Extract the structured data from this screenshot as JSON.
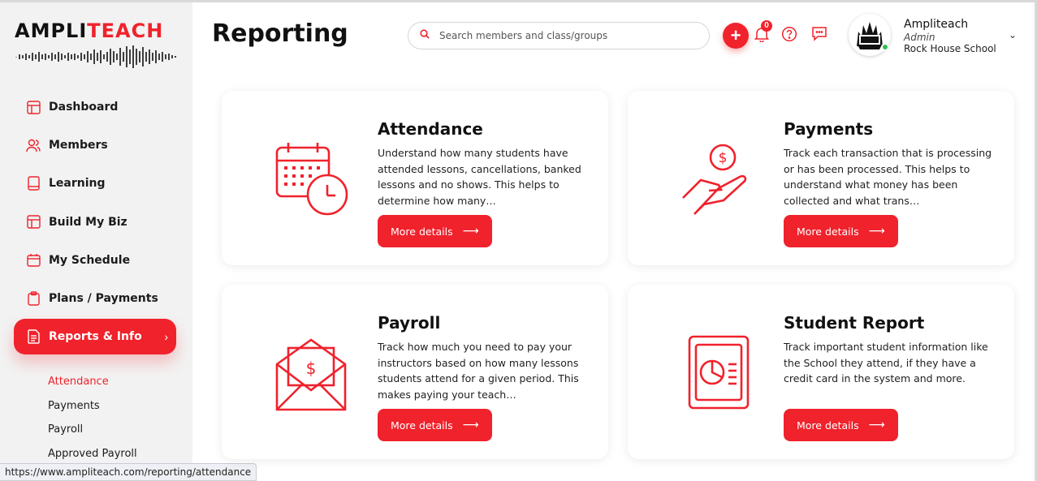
{
  "brand": {
    "logo_word_1": "AMPLI",
    "logo_word_2": "TEACH",
    "accent": "#f0222c"
  },
  "sidebar": {
    "items": [
      {
        "label": "Dashboard",
        "icon": "dashboard-icon"
      },
      {
        "label": "Members",
        "icon": "members-icon"
      },
      {
        "label": "Learning",
        "icon": "book-icon"
      },
      {
        "label": "Build My Biz",
        "icon": "layout-icon"
      },
      {
        "label": "My Schedule",
        "icon": "calendar-icon"
      },
      {
        "label": "Plans / Payments",
        "icon": "clipboard-icon"
      },
      {
        "label": "Reports & Info",
        "icon": "report-icon",
        "active": true
      }
    ],
    "sub_items": [
      {
        "label": "Attendance",
        "active": true
      },
      {
        "label": "Payments"
      },
      {
        "label": "Payroll"
      },
      {
        "label": "Approved Payroll"
      }
    ]
  },
  "header": {
    "title": "Reporting",
    "search_placeholder": "Search members and class/groups",
    "notification_count": "0",
    "user": {
      "name": "Ampliteach",
      "role": "Admin",
      "org": "Rock House School"
    }
  },
  "cards": [
    {
      "title": "Attendance",
      "description": "Understand how many students have attended lessons, cancellations, banked lessons and no shows. This helps to determine how many…",
      "button": "More details",
      "icon": "calendar-clock-icon"
    },
    {
      "title": "Payments",
      "description": "Track each transaction that is processing or has been processed. This helps to understand what money has been collected and what trans…",
      "button": "More details",
      "icon": "hand-coin-icon"
    },
    {
      "title": "Payroll",
      "description": "Track how much you need to pay your instructors based on how many lessons students attend for a given period. This makes paying your teach…",
      "button": "More details",
      "icon": "envelope-money-icon"
    },
    {
      "title": "Student Report",
      "description": "Track important student information like the School they attend, if they have a credit card in the system and more.",
      "button": "More details",
      "icon": "report-chart-icon"
    }
  ],
  "status_url": "https://www.ampliteach.com/reporting/attendance"
}
